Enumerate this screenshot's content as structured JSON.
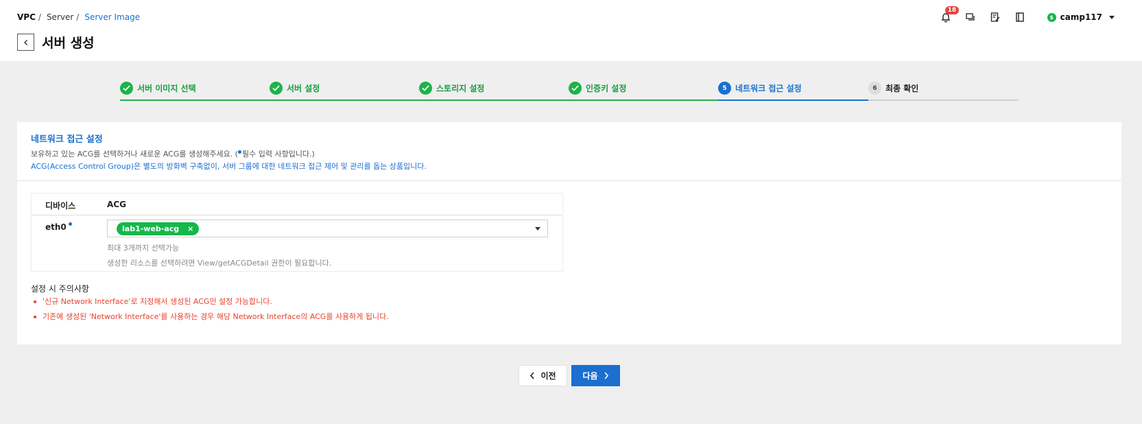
{
  "breadcrumb": {
    "root": "VPC",
    "sep": "/",
    "middle": "Server",
    "current": "Server Image"
  },
  "page_title": "서버 생성",
  "header": {
    "notifications_count": "18",
    "user_badge": "$",
    "username": "camp117"
  },
  "stepper": {
    "steps": [
      {
        "number": "1",
        "label": "서버 이미지 선택",
        "state": "done"
      },
      {
        "number": "2",
        "label": "서버 설정",
        "state": "done"
      },
      {
        "number": "3",
        "label": "스토리지 설정",
        "state": "done"
      },
      {
        "number": "4",
        "label": "인증키 설정",
        "state": "done"
      },
      {
        "number": "5",
        "label": "네트워크 접근 설정",
        "state": "active"
      },
      {
        "number": "6",
        "label": "최종 확인",
        "state": "todo"
      }
    ]
  },
  "section": {
    "title": "네트워크 접근 설정",
    "desc_part1": "보유하고 있는 ACG를 선택하거나 새로운 ACG를 생성해주세요. (",
    "desc_part2": "필수 입력 사항입니다.)",
    "desc_acg": "ACG(Access Control Group)은 별도의 방화벽 구축없이, 서버 그룹에 대한 네트워크 접근 제어 및 관리를 돕는 상품입니다."
  },
  "acg_table": {
    "col_device": "디바이스",
    "col_acg": "ACG",
    "device": "eth0",
    "selected_acg": "lab1-web-acg",
    "chip_remove": "×",
    "hint_max": "최대 3개까지 선택가능",
    "hint_permission": "생성한 리소스를 선택하려면 View/getACGDetail 권한이 필요합니다."
  },
  "caution": {
    "title": "설정 시 주의사항",
    "items": [
      "'신규 Network Interface'로 지정해서 생성된 ACG만 설정 가능합니다.",
      "기존에 생성된 'Network Interface'를 사용하는 경우 해당 Network Interface의 ACG를 사용하게 됩니다."
    ]
  },
  "buttons": {
    "prev": "이전",
    "next": "다음"
  },
  "colors": {
    "primary": "#1a6fd1",
    "success": "#1db34a",
    "danger": "#e8412c"
  }
}
